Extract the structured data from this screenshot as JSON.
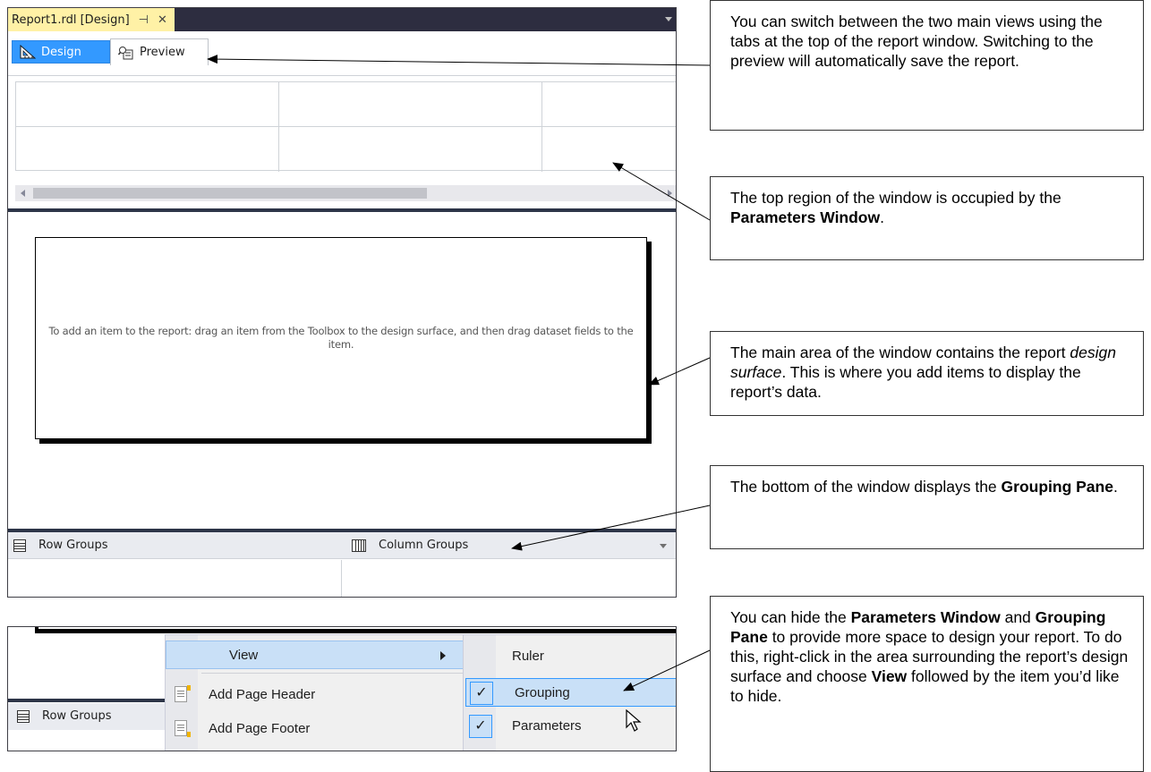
{
  "window": {
    "doc_tab": "Report1.rdl [Design]",
    "pin_glyph": "⊣",
    "close_glyph": "✕"
  },
  "view_tabs": [
    {
      "label": "Design",
      "icon": "design-ruler-icon",
      "selected": true
    },
    {
      "label": "Preview",
      "icon": "preview-icon",
      "selected": false
    }
  ],
  "design_surface": {
    "hint": "To add an item to the report: drag an item from the Toolbox to the design surface, and then drag dataset fields to the item."
  },
  "grouping_pane": {
    "row_groups": "Row Groups",
    "column_groups": "Column Groups"
  },
  "context_menu": {
    "items": [
      "View",
      "Add Page Header",
      "Add Page Footer"
    ],
    "submenu": [
      {
        "label": "Ruler",
        "checked": false
      },
      {
        "label": "Grouping",
        "checked": true
      },
      {
        "label": "Parameters",
        "checked": true
      }
    ],
    "check_glyph": "✓"
  },
  "callouts": {
    "c1": "You can switch between the two main views using the tabs at the top of the report window.  Switching to the preview will automatically save the report.",
    "c2_pre": "The top region of the window is occupied by the ",
    "c2_bold": "Parameters Window",
    "c2_post": ".",
    "c3_pre": "The main area of the window contains the report ",
    "c3_italic": "design surface",
    "c3_post": ".  This is where you add items to display the report’s data.",
    "c4_pre": "The bottom of the window displays the ",
    "c4_bold": "Grouping Pane",
    "c4_post": ".",
    "c5_a": "You can hide the ",
    "c5_b": "Parameters Window",
    "c5_c": " and ",
    "c5_d": "Grouping Pane",
    "c5_e": " to provide more space to design your report.  To do this, right-click in the area surrounding the report’s design surface and choose ",
    "c5_f": "View",
    "c5_g": " followed by the item you’d like to hide."
  },
  "colors": {
    "accent": "#3399ff",
    "tab_yellow": "#fff1a6",
    "chrome_dark": "#2d2d40",
    "menu_highlight": "#c9e0f7"
  }
}
